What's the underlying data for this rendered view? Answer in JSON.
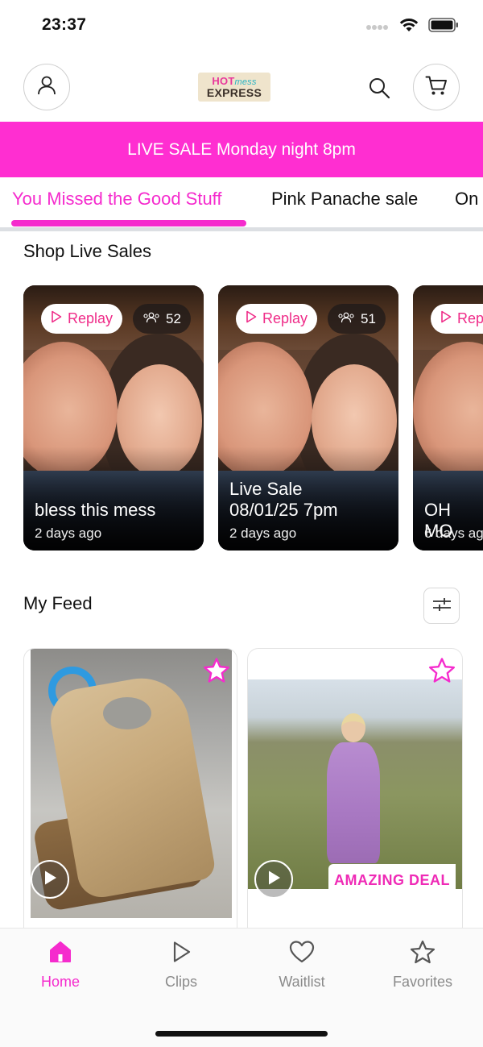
{
  "status_bar": {
    "time": "23:37"
  },
  "header": {
    "logo_line1_a": "HOT",
    "logo_line1_b": "mess",
    "logo_line2": "EXPRESS"
  },
  "banner": {
    "text": "LIVE SALE Monday  night 8pm"
  },
  "tabs": [
    {
      "label": "You Missed the Good Stuff",
      "active": true
    },
    {
      "label": "Pink Panache sale",
      "active": false
    },
    {
      "label": "On",
      "active": false
    }
  ],
  "live_section": {
    "title": "Shop Live Sales",
    "cards": [
      {
        "replay_label": "Replay",
        "viewers": "52",
        "title": "bless this mess",
        "time": "2 days ago"
      },
      {
        "replay_label": "Replay",
        "viewers": "51",
        "title": "Live Sale\n08/01/25 7pm",
        "time": "2 days ago"
      },
      {
        "replay_label": "Rep",
        "title": "OH MO",
        "time": "6 days ag"
      }
    ]
  },
  "feed": {
    "title": "My Feed",
    "badge": "AMAZING DEAL"
  },
  "bottom_nav": [
    {
      "label": "Home",
      "icon": "home-icon",
      "active": true
    },
    {
      "label": "Clips",
      "icon": "play-icon",
      "active": false
    },
    {
      "label": "Waitlist",
      "icon": "heart-icon",
      "active": false
    },
    {
      "label": "Favorites",
      "icon": "star-icon",
      "active": false
    }
  ],
  "colors": {
    "accent": "#f52bcd",
    "banner": "#ff2ed1"
  }
}
